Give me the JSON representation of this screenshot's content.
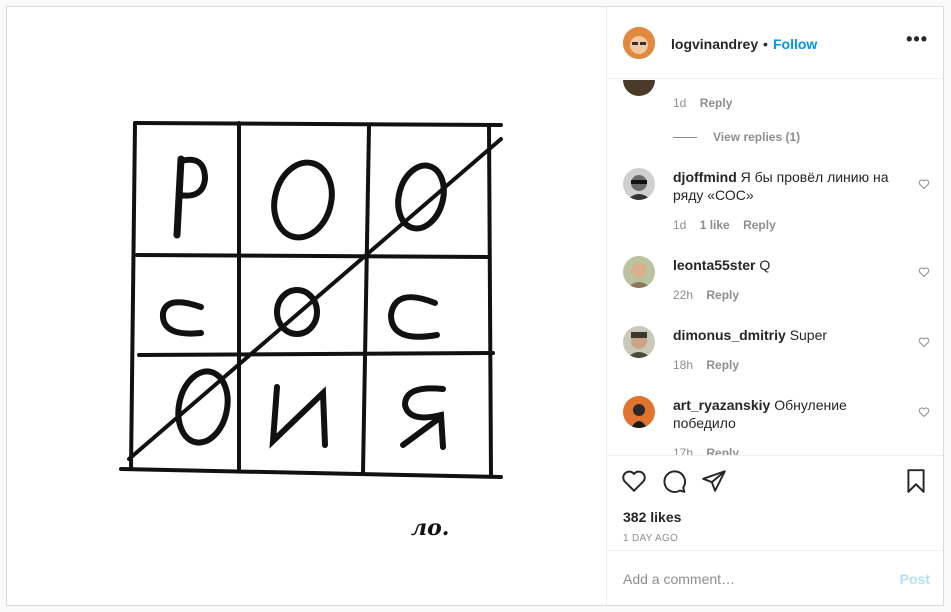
{
  "header": {
    "username": "logvinandrey",
    "dot": "•",
    "follow_label": "Follow",
    "more_label": "•••"
  },
  "comments": [
    {
      "id": "prev",
      "meta": {
        "time": "1d",
        "reply": "Reply"
      },
      "view_replies": "View replies (1)"
    },
    {
      "id": "c1",
      "user": "djoffmind",
      "text": "Я бы провёл линию на ряду «СОС»",
      "meta": {
        "time": "1d",
        "likes": "1 like",
        "reply": "Reply"
      },
      "avatar_color": "#5a5a5a"
    },
    {
      "id": "c2",
      "user": "leonta55ster",
      "text": "Q",
      "meta": {
        "time": "22h",
        "reply": "Reply"
      },
      "avatar_color": "#9a8a6a"
    },
    {
      "id": "c3",
      "user": "dimonus_dmitriy",
      "text": "Super",
      "meta": {
        "time": "18h",
        "reply": "Reply"
      },
      "avatar_color": "#6b6b5a"
    },
    {
      "id": "c4",
      "user": "art_ryazanskiy",
      "text": "Обнуление победило",
      "meta": {
        "time": "17h",
        "reply": "Reply"
      },
      "avatar_color": "#d96a2a"
    }
  ],
  "actions": {
    "icons": [
      "heart-icon",
      "comment-icon",
      "share-icon",
      "bookmark-icon"
    ],
    "likes": "382 likes",
    "ago": "1 DAY AGO"
  },
  "add_comment": {
    "placeholder": "Add a comment…",
    "post_label": "Post"
  },
  "media": {
    "grid_letters": [
      "Р",
      "О",
      "О",
      "С",
      "О",
      "С",
      "О",
      "И",
      "Я"
    ],
    "signature": "ло."
  },
  "colors": {
    "accent": "#0095f6",
    "post_disabled": "#b2dffc",
    "muted": "#8e8e8e"
  }
}
